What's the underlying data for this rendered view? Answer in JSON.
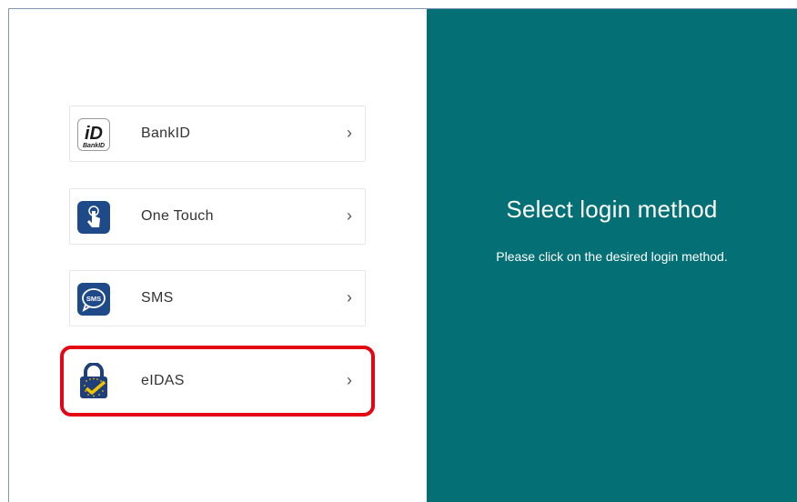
{
  "login": {
    "title": "Select login method",
    "subtitle": "Please click on the desired login method.",
    "methods": [
      {
        "label": "BankID",
        "icon": "bankid-icon",
        "chevron": "›"
      },
      {
        "label": "One Touch",
        "icon": "one-touch-icon",
        "chevron": "›"
      },
      {
        "label": "SMS",
        "icon": "sms-icon",
        "chevron": "›"
      },
      {
        "label": "eIDAS",
        "icon": "eidas-icon",
        "chevron": "›"
      }
    ],
    "bankid_logo_text": "BankID",
    "sms_icon_text": "SMS",
    "highlighted_method": "eIDAS"
  },
  "colors": {
    "right_panel": "#046f74",
    "icon_blue": "#1f4a8a",
    "highlight": "#e30613",
    "eidas_check": "#f2c200"
  }
}
